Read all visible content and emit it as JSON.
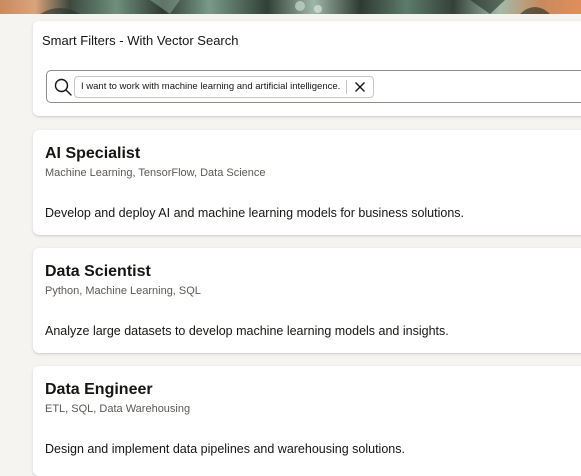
{
  "filter_panel": {
    "title": "Smart Filters - With Vector Search",
    "query_chip": "I want to work with machine learning and artificial intelligence."
  },
  "results": [
    {
      "title": "AI Specialist",
      "skills": "Machine Learning, TensorFlow, Data Science",
      "description": "Develop and deploy AI and machine learning models for business solutions."
    },
    {
      "title": "Data Scientist",
      "skills": "Python, Machine Learning, SQL",
      "description": "Analyze large datasets to develop machine learning models and insights."
    },
    {
      "title": "Data Engineer",
      "skills": "ETL, SQL, Data Warehousing",
      "description": "Design and implement data pipelines and warehousing solutions."
    }
  ],
  "icons": {
    "search": "search-icon",
    "remove_chip": "close-icon"
  }
}
